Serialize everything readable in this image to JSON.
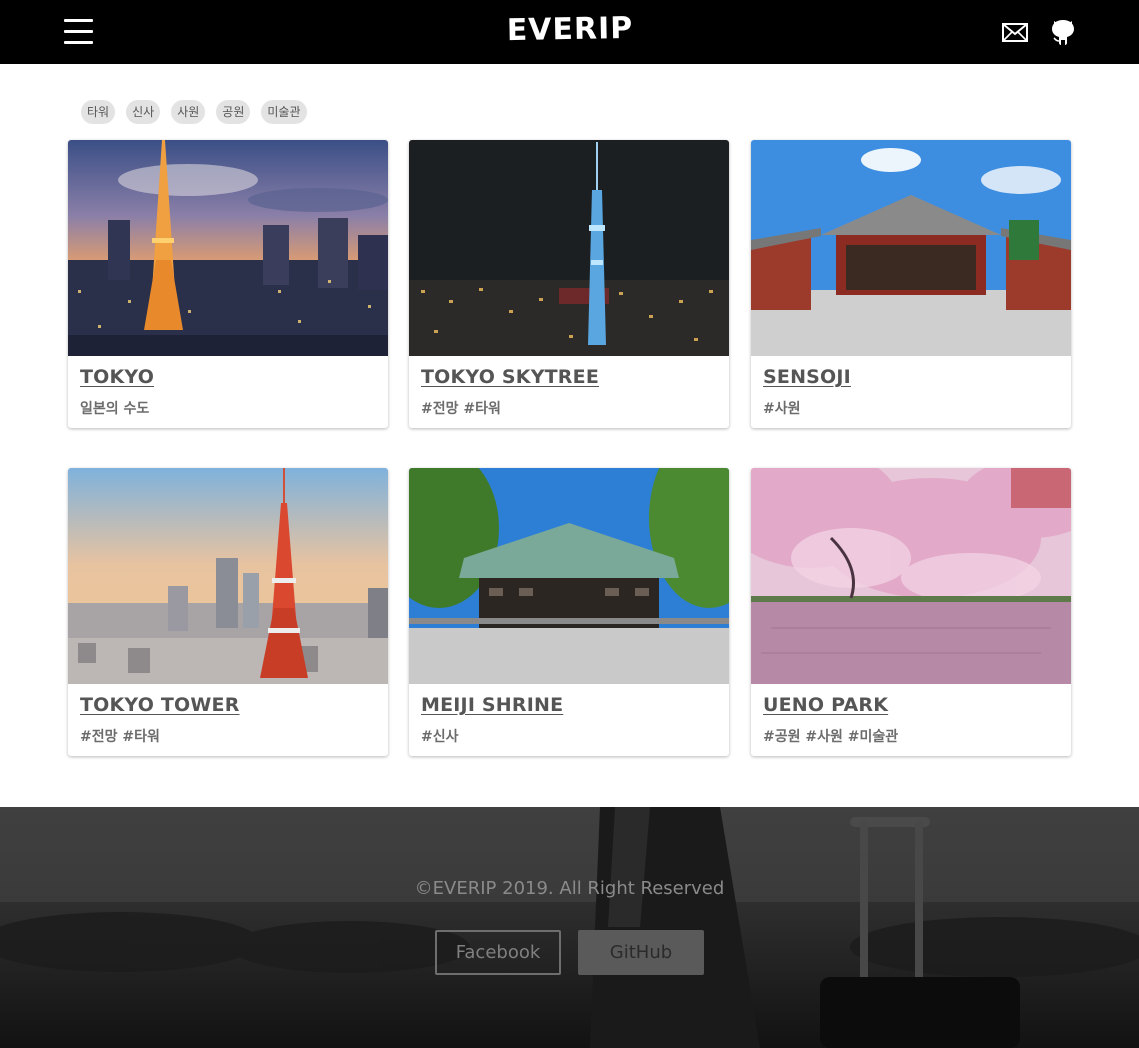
{
  "header": {
    "logo": "EVERIP",
    "menu_icon": "hamburger-menu-icon",
    "mail_icon": "mail-icon",
    "github_icon": "github-icon"
  },
  "tags": [
    "타워",
    "신사",
    "사원",
    "공원",
    "미술관"
  ],
  "cards": [
    {
      "title": "TOKYO",
      "subtitle": "일본의 수도",
      "image": "tokyo-skyline-tower-dusk"
    },
    {
      "title": "TOKYO SKYTREE",
      "subtitle": "#전망 #타워",
      "image": "skytree-night"
    },
    {
      "title": "SENSOJI",
      "subtitle": "#사원",
      "image": "sensoji-temple"
    },
    {
      "title": "TOKYO TOWER",
      "subtitle": "#전망 #타워",
      "image": "tokyo-tower-sunset"
    },
    {
      "title": "MEIJI SHRINE",
      "subtitle": "#신사",
      "image": "meiji-shrine"
    },
    {
      "title": "UENO PARK",
      "subtitle": "#공원 #사원 #미술관",
      "image": "ueno-park-cherry-blossoms"
    }
  ],
  "footer": {
    "copyright": "©EVERIP 2019. All Right Reserved",
    "facebook_label": "Facebook",
    "github_label": "GitHub"
  },
  "colors": {
    "header_bg": "#000000",
    "tag_bg": "#e3e3e3",
    "text": "#555555"
  }
}
